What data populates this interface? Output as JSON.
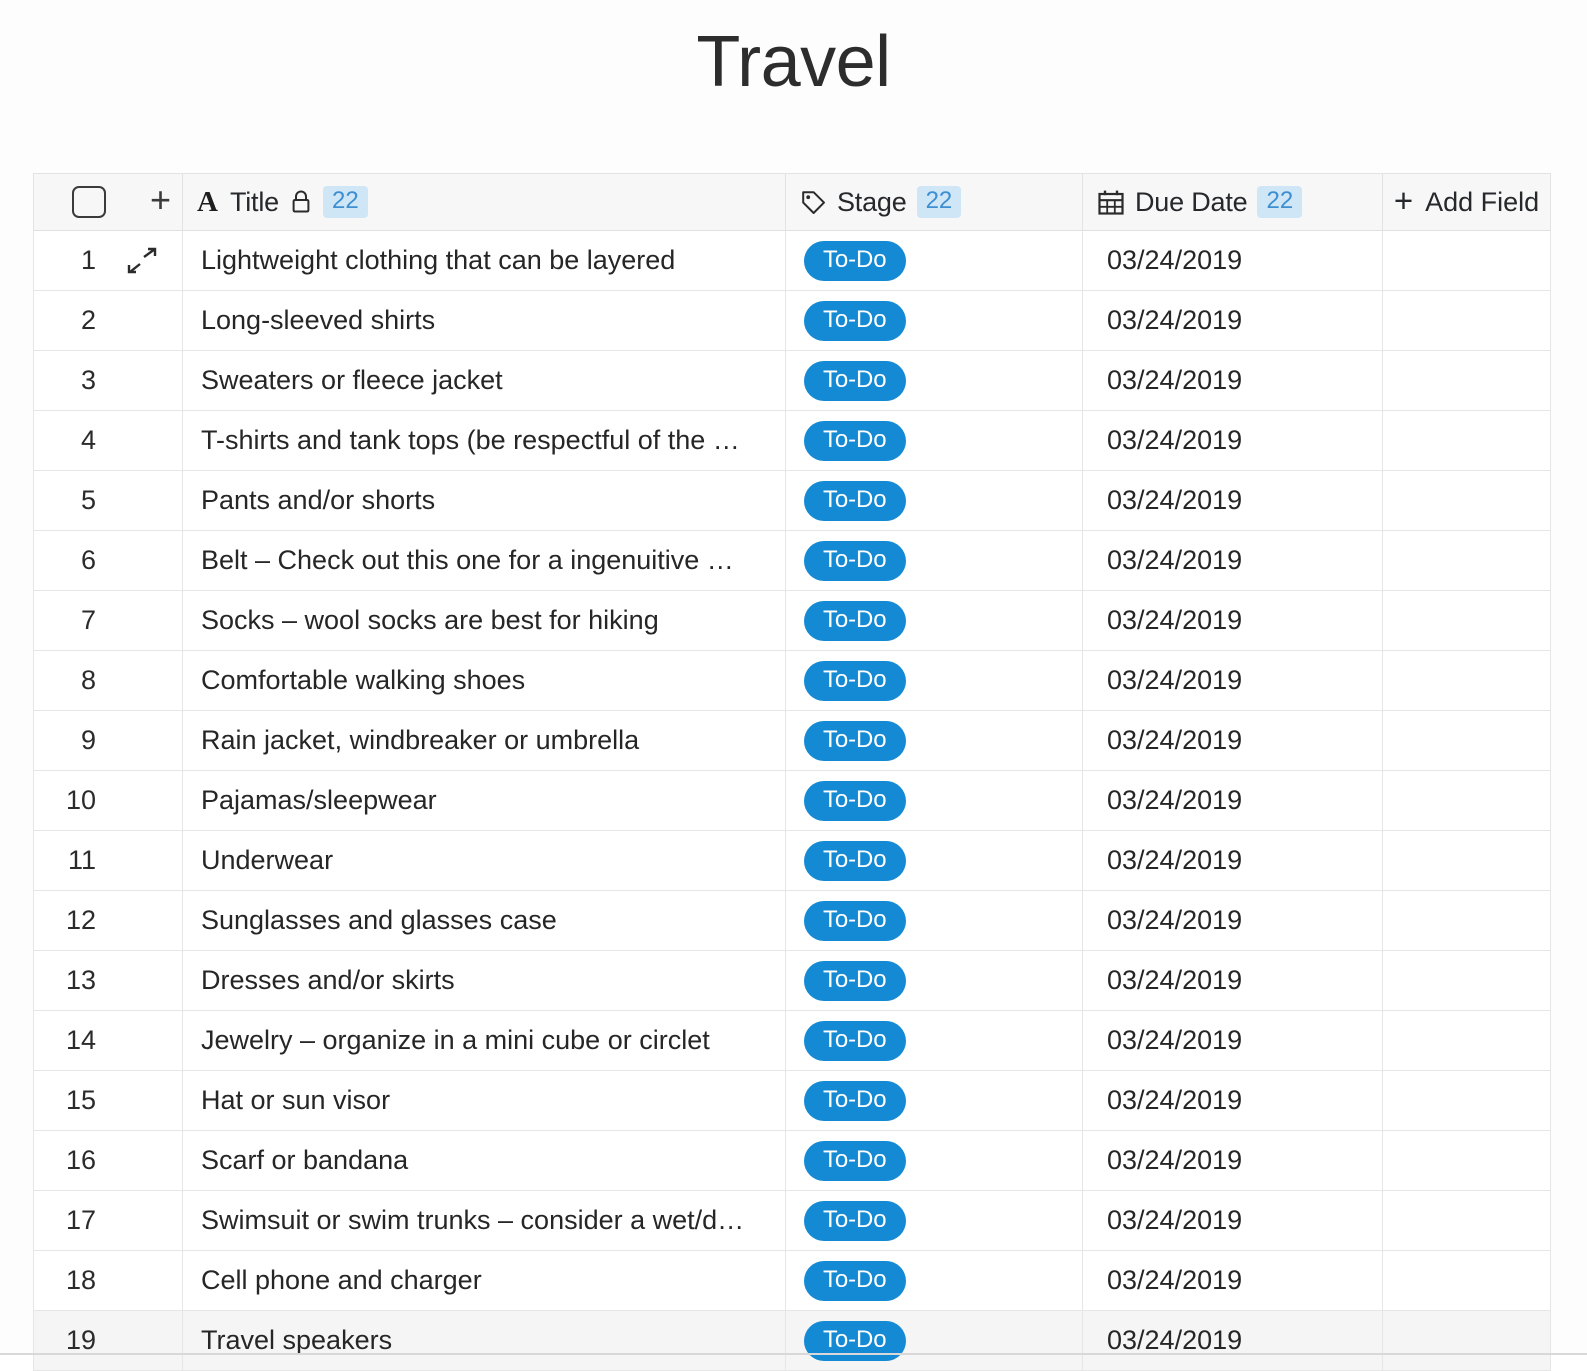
{
  "page": {
    "title": "Travel"
  },
  "table": {
    "columns": [
      {
        "key": "control",
        "label": "",
        "icons": [
          "checkbox-icon",
          "plus-icon"
        ]
      },
      {
        "key": "title",
        "label": "Title",
        "icon": "text-field-icon",
        "lock": "lock-icon",
        "count": "22"
      },
      {
        "key": "stage",
        "label": "Stage",
        "icon": "tag-icon",
        "count": "22"
      },
      {
        "key": "due_date",
        "label": "Due Date",
        "icon": "calendar-icon",
        "count": "22"
      },
      {
        "key": "add_field",
        "label": "Add Field",
        "icon": "plus-icon"
      }
    ],
    "rows": [
      {
        "num": "1",
        "title": "Lightweight clothing that can be layered",
        "stage": "To-Do",
        "due": "03/24/2019",
        "expand": true
      },
      {
        "num": "2",
        "title": "Long-sleeved shirts",
        "stage": "To-Do",
        "due": "03/24/2019"
      },
      {
        "num": "3",
        "title": "Sweaters or fleece jacket",
        "stage": "To-Do",
        "due": "03/24/2019"
      },
      {
        "num": "4",
        "title": "T-shirts and tank tops (be respectful of the …",
        "stage": "To-Do",
        "due": "03/24/2019"
      },
      {
        "num": "5",
        "title": "Pants and/or shorts",
        "stage": "To-Do",
        "due": "03/24/2019"
      },
      {
        "num": "6",
        "title": "Belt – Check out this one for a ingenuitive …",
        "stage": "To-Do",
        "due": "03/24/2019"
      },
      {
        "num": "7",
        "title": "Socks – wool socks are best for hiking",
        "stage": "To-Do",
        "due": "03/24/2019"
      },
      {
        "num": "8",
        "title": "Comfortable walking shoes",
        "stage": "To-Do",
        "due": "03/24/2019"
      },
      {
        "num": "9",
        "title": "Rain jacket, windbreaker or umbrella",
        "stage": "To-Do",
        "due": "03/24/2019"
      },
      {
        "num": "10",
        "title": "Pajamas/sleepwear",
        "stage": "To-Do",
        "due": "03/24/2019"
      },
      {
        "num": "11",
        "title": "Underwear",
        "stage": "To-Do",
        "due": "03/24/2019"
      },
      {
        "num": "12",
        "title": "Sunglasses and glasses case",
        "stage": "To-Do",
        "due": "03/24/2019"
      },
      {
        "num": "13",
        "title": "Dresses and/or skirts",
        "stage": "To-Do",
        "due": "03/24/2019"
      },
      {
        "num": "14",
        "title": "Jewelry – organize in a mini cube or circlet",
        "stage": "To-Do",
        "due": "03/24/2019"
      },
      {
        "num": "15",
        "title": "Hat or sun visor",
        "stage": "To-Do",
        "due": "03/24/2019"
      },
      {
        "num": "16",
        "title": "Scarf or bandana",
        "stage": "To-Do",
        "due": "03/24/2019"
      },
      {
        "num": "17",
        "title": "Swimsuit or swim trunks – consider a wet/d…",
        "stage": "To-Do",
        "due": "03/24/2019"
      },
      {
        "num": "18",
        "title": "Cell phone and charger",
        "stage": "To-Do",
        "due": "03/24/2019"
      },
      {
        "num": "19",
        "title": "Travel speakers",
        "stage": "To-Do",
        "due": "03/24/2019",
        "highlight": true
      }
    ]
  },
  "colors": {
    "tag_blue": "#1489d4",
    "count_badge_bg": "#cfe6f7",
    "count_badge_text": "#3d8fd1",
    "header_bg": "#f7f7f7",
    "grid_line": "#e6e6e6"
  }
}
